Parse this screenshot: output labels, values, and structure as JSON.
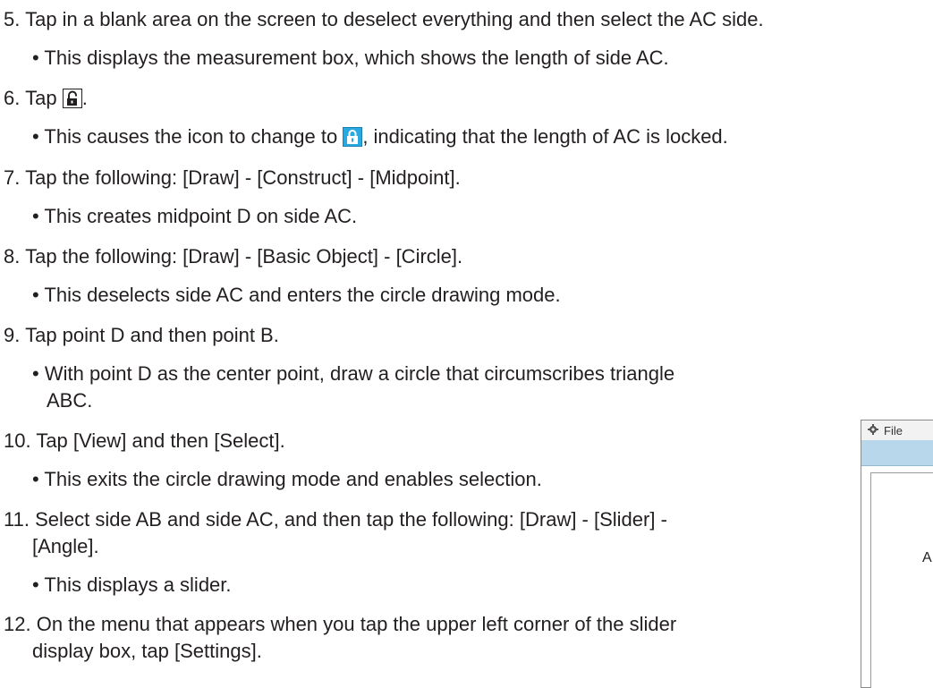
{
  "steps": [
    {
      "number": "5.",
      "text": "Tap in a blank area on the screen to deselect everything and then select the AC side.",
      "bullets": [
        "This displays the measurement box, which shows the length of side AC."
      ]
    },
    {
      "number": "6.",
      "text_before_icon": "Tap",
      "icon": "unlocked-padlock-icon",
      "text_after_icon": ".",
      "bullet_before_icon": "This causes the icon to change to",
      "bullet_icon": "locked-padlock-icon",
      "bullet_after_icon": ", indicating that the length of AC is locked."
    },
    {
      "number": "7.",
      "text": "Tap the following: [Draw] - [Construct] - [Midpoint].",
      "bullets": [
        "This creates midpoint D on side AC."
      ]
    },
    {
      "number": "8.",
      "text": "Tap the following: [Draw] - [Basic Object] - [Circle].",
      "bullets": [
        "This deselects side AC and enters the circle drawing mode."
      ]
    },
    {
      "number": "9.",
      "text": "Tap point D and then point B.",
      "bullets": [
        "With point D as the center point, draw a circle that circumscribes triangle",
        "ABC."
      ]
    },
    {
      "number": "10.",
      "text": "Tap [View] and then [Select].",
      "bullets": [
        "This exits the circle drawing mode and enables selection."
      ]
    },
    {
      "number": "11.",
      "text": "Select side AB and side AC, and then tap the following: [Draw] - [Slider] -",
      "text_cont": "[Angle].",
      "bullets": [
        "This displays a slider."
      ]
    },
    {
      "number": "12.",
      "text": "On the menu that appears when you tap the upper left corner of the slider",
      "text_cont": "display box, tap [Settings]."
    }
  ],
  "bullet_char": "•",
  "app_window": {
    "menu_icon": "gear-icon",
    "menu_label": "File",
    "canvas_label": "A",
    "toolbar_color": "#b9d7ea",
    "locked_icon_color": "#2aa9e0"
  }
}
